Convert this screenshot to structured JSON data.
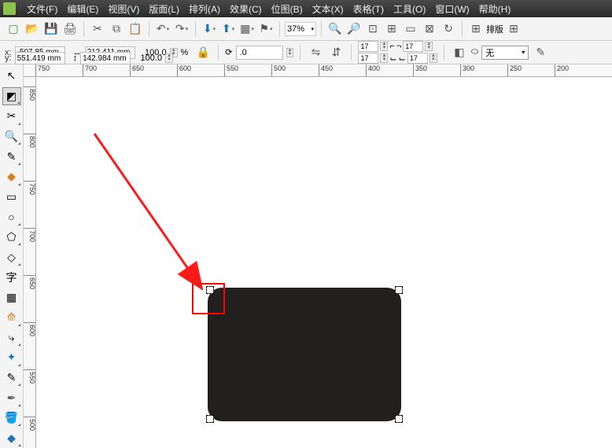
{
  "menu": {
    "items": [
      "文件(F)",
      "编辑(E)",
      "视图(V)",
      "版面(L)",
      "排列(A)",
      "效果(C)",
      "位图(B)",
      "文本(X)",
      "表格(T)",
      "工具(O)",
      "窗口(W)",
      "帮助(H)"
    ]
  },
  "toolbar1": {
    "zoom": "37%",
    "layout_label": "排版"
  },
  "props": {
    "x_label": "x:",
    "x_value": "-507.85 mm",
    "y_label": "y:",
    "y_value": "551.419 mm",
    "w_value": "212.411 mm",
    "h_value": "142.984 mm",
    "scale_x": "100.0",
    "scale_y": "100.0",
    "pct": "%",
    "rotation": ".0",
    "grid_a1": "17",
    "grid_a2": "17",
    "grid_b1": "17",
    "grid_b2": "17",
    "wrap_label": "无"
  },
  "ruler_h": [
    "750",
    "700",
    "650",
    "600",
    "550",
    "500",
    "450",
    "400",
    "350",
    "300",
    "250",
    "200"
  ],
  "ruler_v": [
    "850",
    "800",
    "750",
    "700",
    "650",
    "600",
    "550",
    "500"
  ],
  "annotation": {
    "note": "Red arrow pointing at top-left corner radius handle of rounded rectangle shape"
  }
}
